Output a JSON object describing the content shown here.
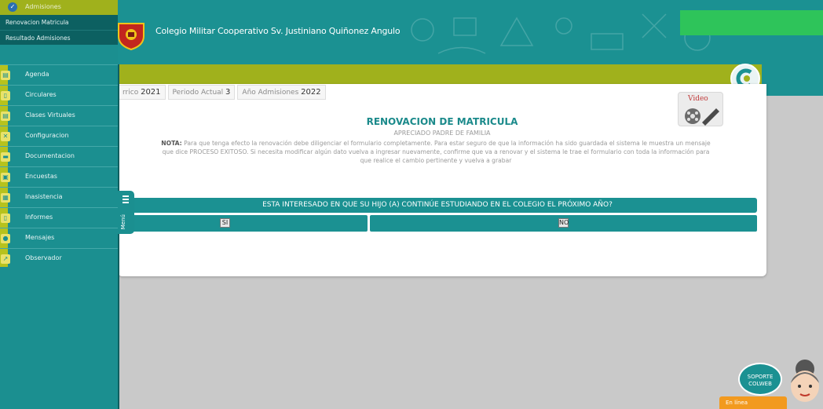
{
  "header": {
    "school_name": "Colegio Militar Cooperativo Sv. Justiniano Quiñonez Angulo"
  },
  "sidebar": {
    "section_label": "Admisiones",
    "sub_items": [
      "Renovacion Matricula",
      "Resultado Admisiones"
    ],
    "items": [
      {
        "label": "Agenda",
        "icon": "agenda-icon"
      },
      {
        "label": "Circulares",
        "icon": "document-icon"
      },
      {
        "label": "Clases Virtuales",
        "icon": "virtual-class-icon"
      },
      {
        "label": "Configuracion",
        "icon": "tools-icon"
      },
      {
        "label": "Documentacion",
        "icon": "folder-icon"
      },
      {
        "label": "Encuestas",
        "icon": "survey-icon"
      },
      {
        "label": "Inasistencia",
        "icon": "calendar-icon"
      },
      {
        "label": "Informes",
        "icon": "report-icon"
      },
      {
        "label": "Mensajes",
        "icon": "message-icon"
      },
      {
        "label": "Observador",
        "icon": "chart-icon"
      }
    ],
    "menu_tab_label": "Menú"
  },
  "period": {
    "year_label": "rrico",
    "year_value": "2021",
    "period_label": "Periodo Actual",
    "period_value": "3",
    "admission_label": "Año Admisiones",
    "admission_value": "2022"
  },
  "video_button_label": "Video",
  "form": {
    "title": "RENOVACION DE MATRICULA",
    "subtitle": "APRECIADO PADRE DE FAMILIA",
    "note_prefix": "NOTA:",
    "note_text": "Para que tenga efecto la renovación debe diligenciar el formulario completamente. Para estar seguro de que la información ha sido guardada el sistema le muestra un mensaje que dice PROCESO EXITOSO. Si necesita modificar algún dato vuelva a ingresar nuevamente, confirme que va a renovar y el sistema le trae el formulario con toda la información para que realice el cambio pertinente y vuelva a grabar",
    "question": "ESTA INTERESADO EN QUE SU HIJO (A) CONTINÚE ESTUDIANDO EN EL COLEGIO EL PRÓXIMO AÑO?",
    "option_yes": "SI",
    "option_no": "NO"
  },
  "assistant": {
    "bubble_text": "SOPORTE COLWEB",
    "chat_label": "En línea"
  },
  "colors": {
    "teal": "#1b9192",
    "olive": "#a0b11c",
    "green": "#2ec45a",
    "orange": "#f29a1f"
  }
}
